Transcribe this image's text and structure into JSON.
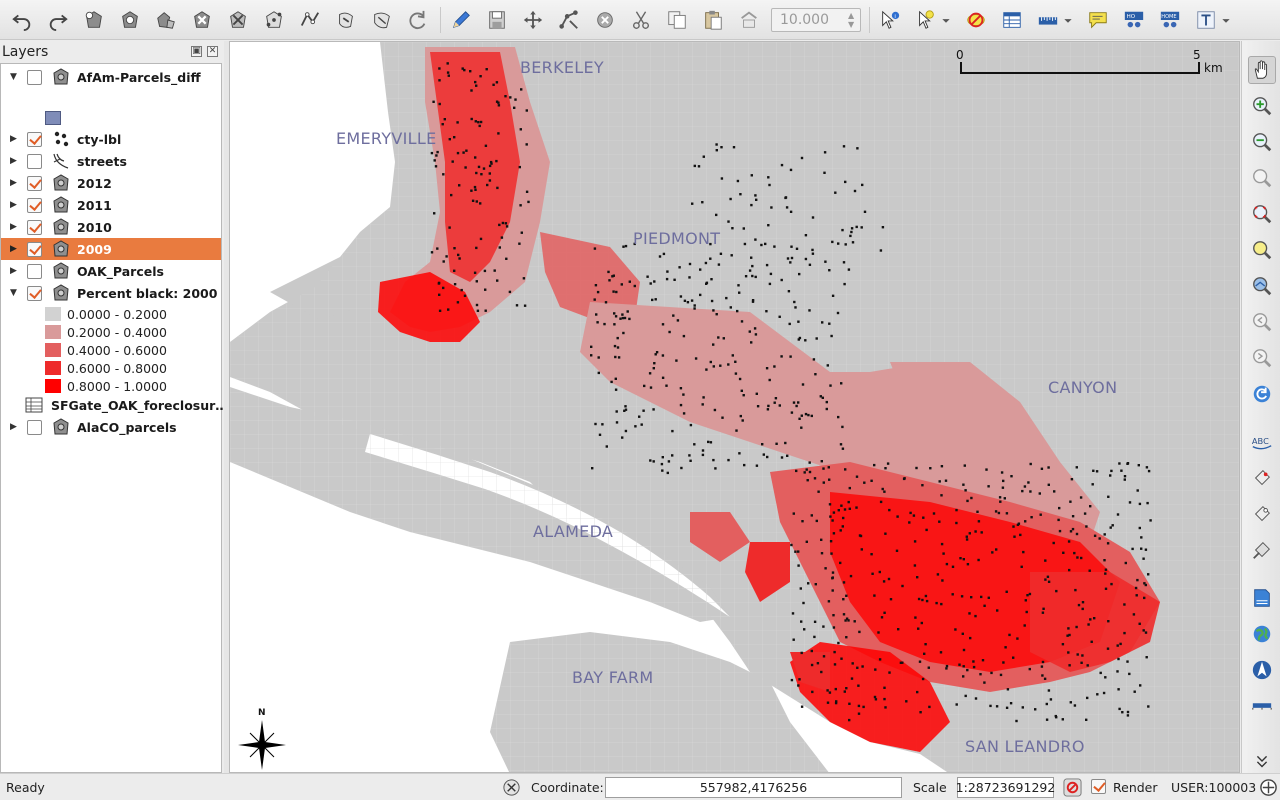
{
  "layers_panel": {
    "title": "Layers",
    "float_glyph": "▣",
    "close_glyph": "✕",
    "layers": [
      {
        "name": "AfAm-Parcels_diff",
        "checked": false,
        "expanded": true,
        "icon": "polygon-layer-icon"
      },
      {
        "name": "cty-lbl",
        "checked": true,
        "expanded": false,
        "icon": "point-layer-icon"
      },
      {
        "name": "streets",
        "checked": false,
        "expanded": false,
        "icon": "line-layer-icon"
      },
      {
        "name": "2012",
        "checked": true,
        "expanded": false,
        "icon": "polygon-layer-icon"
      },
      {
        "name": "2011",
        "checked": true,
        "expanded": false,
        "icon": "polygon-layer-icon"
      },
      {
        "name": "2010",
        "checked": true,
        "expanded": false,
        "icon": "polygon-layer-icon"
      },
      {
        "name": "2009",
        "checked": true,
        "expanded": false,
        "selected": true,
        "icon": "polygon-layer-icon"
      },
      {
        "name": "OAK_Parcels",
        "checked": false,
        "expanded": false,
        "icon": "polygon-layer-icon"
      },
      {
        "name": "Percent black: 2000",
        "checked": true,
        "expanded": true,
        "icon": "polygon-layer-icon"
      },
      {
        "name": "SFGate_OAK_foreclosur…",
        "checked": null,
        "expanded": null,
        "icon": "table-layer-icon"
      },
      {
        "name": "AlaCO_parcels",
        "checked": false,
        "expanded": false,
        "icon": "polygon-layer-icon"
      }
    ],
    "legend_percent_black": [
      {
        "label": "0.0000 - 0.2000",
        "color": "#d2d2d2"
      },
      {
        "label": "0.2000 - 0.4000",
        "color": "#d99a9a"
      },
      {
        "label": "0.4000 - 0.6000",
        "color": "#e35f5f"
      },
      {
        "label": "0.6000 - 0.8000",
        "color": "#ee2b2b"
      },
      {
        "label": "0.8000 - 1.0000",
        "color": "#ff0000"
      }
    ],
    "afam_swatch_color": "#7f8cb8",
    "selected_color": "#e97b3f"
  },
  "toolbar": {
    "snap_value": "10.000",
    "icons": [
      "undo-icon",
      "redo-icon",
      "add-feature-icon",
      "add-ring-icon",
      "add-part-icon",
      "fill-ring-icon",
      "delete-ring-icon",
      "delete-part-icon",
      "reshape-icon",
      "offset-curve-icon",
      "simplify-icon",
      "rotate-icon",
      "edit-pencil-icon",
      "save-edits-icon",
      "move-feature-icon",
      "node-tool-icon",
      "delete-selected-icon",
      "cut-icon",
      "copy-icon",
      "paste-icon",
      "rotate-point-icon",
      "identify-icon",
      "select-feature-icon",
      "deselect-icon",
      "attribute-table-icon",
      "measure-icon",
      "map-tips-icon",
      "home-icon",
      "text-annotation-icon"
    ]
  },
  "map": {
    "city_labels": [
      {
        "label": "BERKELEY"
      },
      {
        "label": "EMERYVILLE"
      },
      {
        "label": "PIEDMONT"
      },
      {
        "label": "CANYON"
      },
      {
        "label": "ALAMEDA"
      },
      {
        "label": "BAY FARM"
      },
      {
        "label": "SAN LEANDRO"
      }
    ],
    "scalebar": {
      "start": "0",
      "end": "5",
      "unit": "km"
    },
    "north_label": "N",
    "colors": {
      "land": "#c9c9c9",
      "water": "#ffffff",
      "label": "#6e6e9e"
    }
  },
  "statusbar": {
    "status": "Ready",
    "coordinate_label": "Coordinate:",
    "coordinate_value": "557982,4176256",
    "scale_label": "Scale",
    "scale_value": "1:28723691292",
    "render_label": "Render",
    "render_checked": true,
    "user": "USER:100003"
  }
}
